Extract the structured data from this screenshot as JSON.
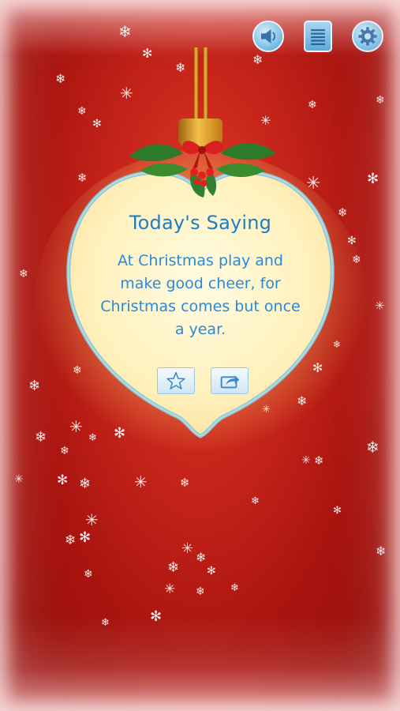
{
  "toolbar": {
    "sound_icon": "speaker-icon",
    "list_icon": "list-icon",
    "settings_icon": "gear-icon"
  },
  "card": {
    "title": "Today's Saying",
    "saying": "At Christmas play and make good cheer, for Christmas comes but once a year.",
    "favorite_icon": "star-icon",
    "share_icon": "share-icon"
  },
  "colors": {
    "background": "#c9261b",
    "card_fill": "#fff3c4",
    "card_border": "#8fc6e8",
    "text": "#1f7cc7",
    "button_accent": "#5aa9da"
  }
}
